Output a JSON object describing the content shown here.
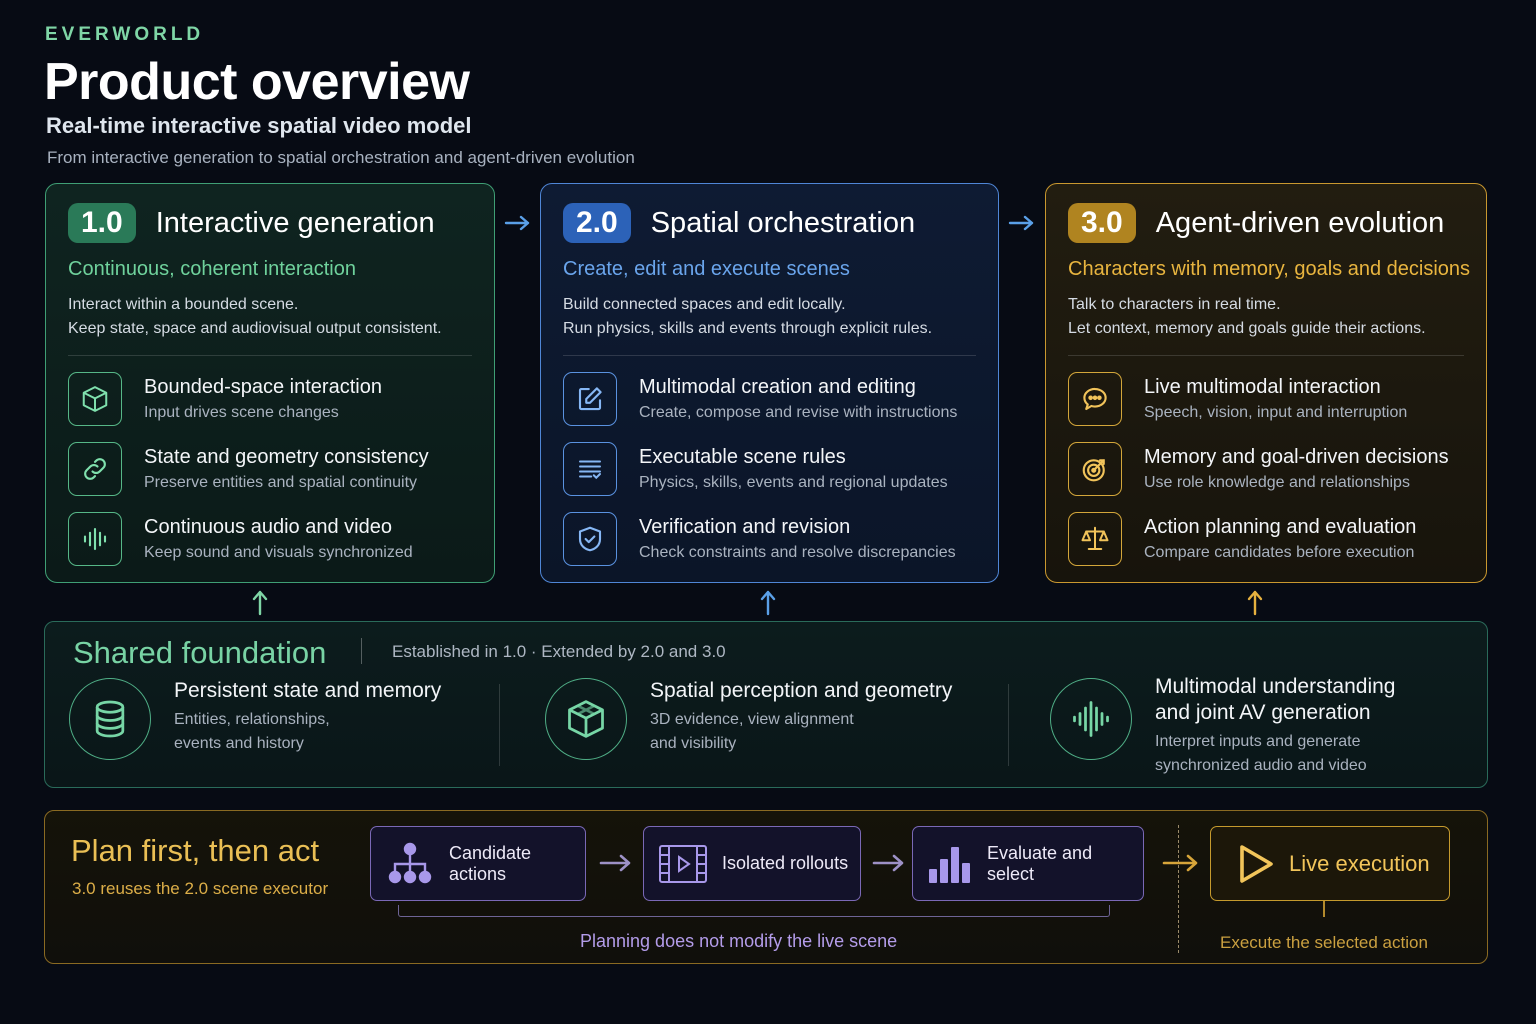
{
  "header": {
    "brand": "EVERWORLD",
    "title": "Product overview",
    "subtitle": "Real-time interactive spatial video model",
    "description": "From interactive generation to spatial orchestration and agent-driven evolution"
  },
  "stages": [
    {
      "badge": "1.0",
      "title": "Interactive generation",
      "subtitle": "Continuous, coherent interaction",
      "body_line1": "Interact within a bounded scene.",
      "body_line2": "Keep state, space and audiovisual output consistent.",
      "items": [
        {
          "title": "Bounded-space interaction",
          "desc": "Input drives scene changes",
          "icon": "cube-icon"
        },
        {
          "title": "State and geometry consistency",
          "desc": "Preserve entities and spatial continuity",
          "icon": "link-icon"
        },
        {
          "title": "Continuous audio and video",
          "desc": "Keep sound and visuals synchronized",
          "icon": "waveform-icon"
        }
      ]
    },
    {
      "badge": "2.0",
      "title": "Spatial orchestration",
      "subtitle": "Create, edit and execute scenes",
      "body_line1": "Build connected spaces and edit locally.",
      "body_line2": "Run physics, skills and events through explicit rules.",
      "items": [
        {
          "title": "Multimodal creation and editing",
          "desc": "Create, compose and revise with instructions",
          "icon": "edit-icon"
        },
        {
          "title": "Executable scene rules",
          "desc": "Physics, skills, events and regional updates",
          "icon": "rules-list-icon"
        },
        {
          "title": "Verification and revision",
          "desc": "Check constraints and resolve discrepancies",
          "icon": "shield-check-icon"
        }
      ]
    },
    {
      "badge": "3.0",
      "title": "Agent-driven evolution",
      "subtitle": "Characters with memory, goals and decisions",
      "body_line1": "Talk to characters in real time.",
      "body_line2": "Let context, memory and goals guide their actions.",
      "items": [
        {
          "title": "Live multimodal interaction",
          "desc": "Speech, vision, input and interruption",
          "icon": "chat-bubble-icon"
        },
        {
          "title": "Memory and goal-driven decisions",
          "desc": "Use role knowledge and relationships",
          "icon": "target-icon"
        },
        {
          "title": "Action planning and evaluation",
          "desc": "Compare candidates before execution",
          "icon": "scales-icon"
        }
      ]
    }
  ],
  "foundation": {
    "title": "Shared foundation",
    "note": "Established in 1.0  ·  Extended by 2.0 and 3.0",
    "columns": [
      {
        "title_line1": "Persistent state and memory",
        "title_line2": "",
        "desc_line1": "Entities, relationships,",
        "desc_line2": "events and history",
        "icon": "database-icon"
      },
      {
        "title_line1": "Spatial perception and geometry",
        "title_line2": "",
        "desc_line1": "3D evidence, view alignment",
        "desc_line2": "and visibility",
        "icon": "cube-icon"
      },
      {
        "title_line1": "Multimodal understanding",
        "title_line2": "and joint AV generation",
        "desc_line1": "Interpret inputs and generate",
        "desc_line2": "synchronized audio and video",
        "icon": "waveform-icon"
      }
    ]
  },
  "plan": {
    "title": "Plan first, then act",
    "subtitle": "3.0 reuses the 2.0 scene executor",
    "steps": [
      {
        "label": "Candidate actions",
        "icon": "tree-icon"
      },
      {
        "label": "Isolated rollouts",
        "icon": "film-play-icon"
      },
      {
        "label": "Evaluate and select",
        "icon": "bar-chart-icon"
      }
    ],
    "live_label": "Live execution",
    "live_icon": "play-icon",
    "planning_note": "Planning does not modify the live scene",
    "execute_note": "Execute the selected action"
  },
  "colors": {
    "green": "#3f9f75",
    "blue": "#4f86d6",
    "gold": "#c9982f",
    "purple": "#7a68b6",
    "background": "#070b14"
  }
}
